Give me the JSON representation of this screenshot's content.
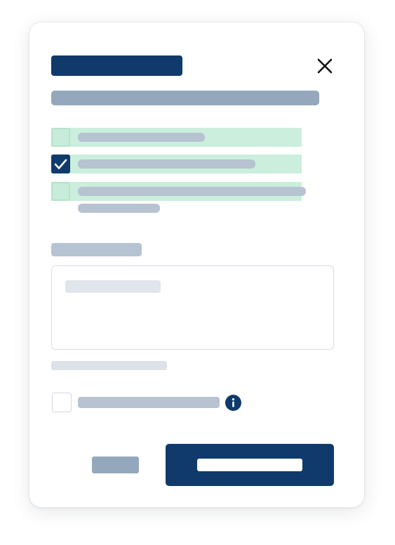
{
  "colors": {
    "primary": "#0f3a6b",
    "heading_muted": "#94a7bc",
    "option_bg": "#cbeedd",
    "checkbox_bg": "#c7ecd9",
    "checkbox_border": "#b7e2cb",
    "placeholder_line": "#b7c3d1"
  },
  "icons": {
    "close": "close-icon",
    "check": "check-icon",
    "info": "info-icon"
  },
  "options": [
    {
      "checked": false
    },
    {
      "checked": true
    },
    {
      "checked": false
    }
  ],
  "consent": {
    "checked": false
  }
}
